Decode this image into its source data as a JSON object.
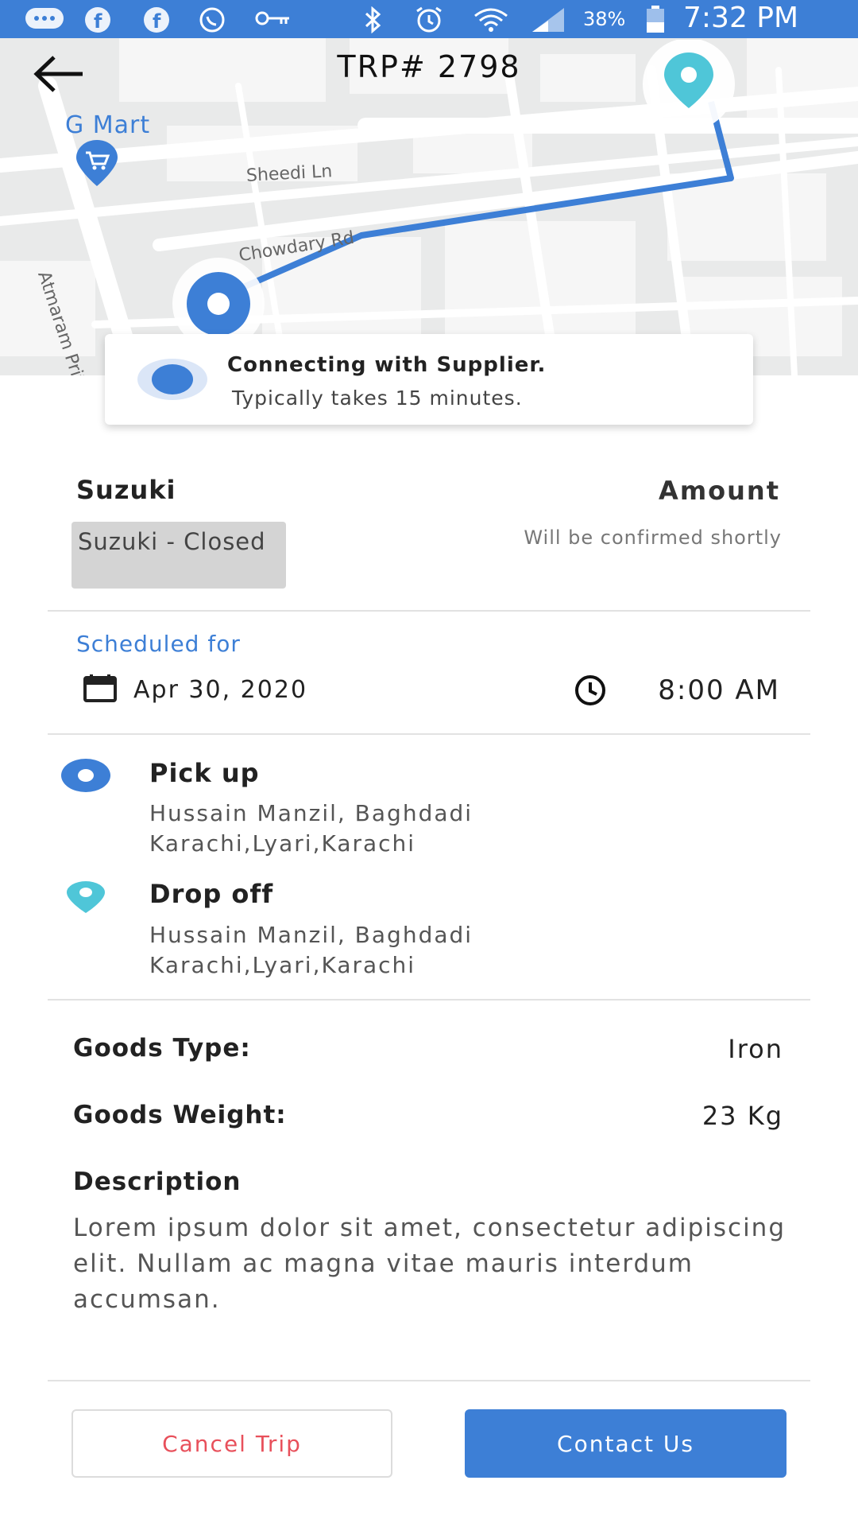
{
  "status_bar": {
    "battery": "38%",
    "time": "7:32 PM",
    "icons": [
      "messages-icon",
      "facebook-icon",
      "facebook-icon",
      "whatsapp-icon",
      "key-icon",
      "bluetooth-icon",
      "alarm-icon",
      "wifi-icon",
      "signal-icon",
      "battery-icon"
    ]
  },
  "header": {
    "title": "TRP# 2798",
    "back_icon": "arrow-left-icon"
  },
  "map": {
    "store_name": "G Mart",
    "roads": [
      "Sheedi Ln",
      "Chowdary Rd",
      "Atmaram Prit"
    ],
    "route_color": "#3d7fd6",
    "pickup_color": "#3d7fd6",
    "dropoff_color": "#4fc6d8"
  },
  "connecting": {
    "title": "Connecting with Supplier.",
    "subtitle": "Typically takes 15 minutes."
  },
  "vehicle": {
    "name": "Suzuki",
    "badge": "Suzuki - Closed"
  },
  "amount": {
    "label": "Amount",
    "note": "Will be confirmed shortly"
  },
  "schedule": {
    "label": "Scheduled for",
    "date": "Apr 30, 2020",
    "time": "8:00 AM"
  },
  "pickup": {
    "label": "Pick up",
    "address": "Hussain Manzil, Baghdadi Karachi,Lyari,Karachi"
  },
  "dropoff": {
    "label": "Drop off",
    "address": "Hussain Manzil, Baghdadi Karachi,Lyari,Karachi"
  },
  "goods": {
    "type_label": "Goods Type:",
    "type_value": "Iron",
    "weight_label": "Goods Weight:",
    "weight_value": "23 Kg",
    "description_label": "Description",
    "description": "Lorem ipsum dolor sit amet, consectetur adipiscing elit. Nullam ac magna vitae mauris interdum accumsan."
  },
  "actions": {
    "cancel": "Cancel Trip",
    "contact": "Contact Us"
  },
  "colors": {
    "primary": "#3d7fd6",
    "danger": "#e8505b",
    "accent_teal": "#4fc6d8"
  }
}
